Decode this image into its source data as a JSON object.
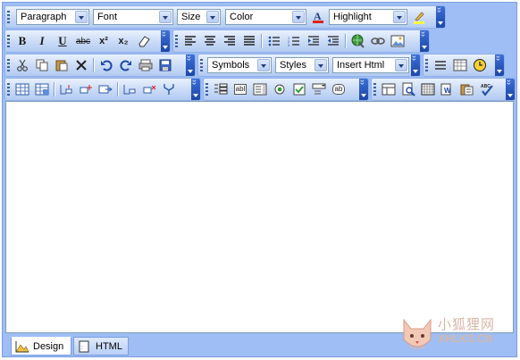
{
  "toolbar1": {
    "paragraph": "Paragraph",
    "font": "Font",
    "size": "Size",
    "color": "Color",
    "highlight": "Highlight"
  },
  "toolbar2": {
    "bold": "B",
    "italic": "I",
    "underline": "U",
    "strikethrough": "abc",
    "superscript": "x²",
    "subscript": "x₂"
  },
  "toolbar3": {
    "symbols": "Symbols",
    "styles": "Styles",
    "insert_html": "Insert Html"
  },
  "form_toolbar": {
    "textbox": "abl",
    "button": "ab"
  },
  "tabs": {
    "design": "Design",
    "html": "HTML"
  },
  "watermark": {
    "chinese": "小狐狸网",
    "latin": "XHLKS.CN"
  },
  "colors": {
    "frame": "#9ebef5",
    "toolbar_bg": "#c6d8f5",
    "accent": "#1d47a8"
  }
}
